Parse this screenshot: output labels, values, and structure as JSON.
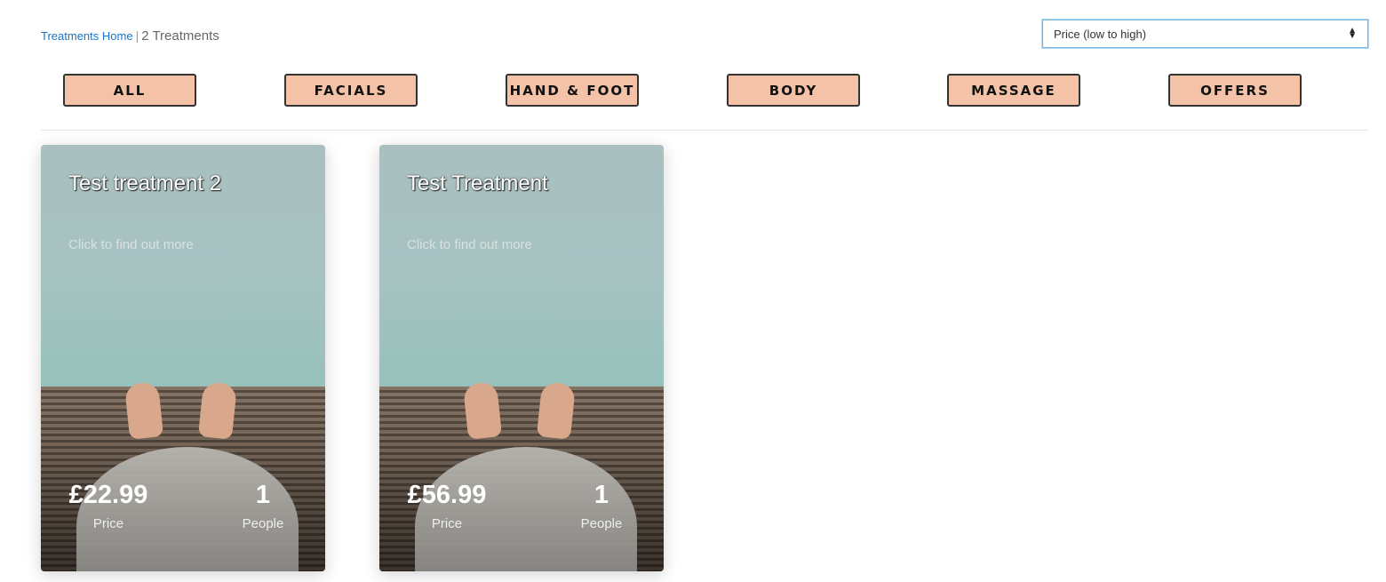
{
  "breadcrumb": {
    "home_label": "Treatments Home",
    "separator": "|",
    "count_label": "2 Treatments"
  },
  "sort": {
    "selected": "Price (low to high)"
  },
  "filters": [
    "ALL",
    "FACIALS",
    "HAND & FOOT",
    "BODY",
    "MASSAGE",
    "OFFERS"
  ],
  "cards": [
    {
      "title": "Test treatment 2",
      "cta": "Click to find out more",
      "price": "£22.99",
      "price_label": "Price",
      "people": "1",
      "people_label": "People"
    },
    {
      "title": "Test Treatment",
      "cta": "Click to find out more",
      "price": "£56.99",
      "price_label": "Price",
      "people": "1",
      "people_label": "People"
    }
  ],
  "colors": {
    "filter_bg": "#f3c2a7",
    "link": "#1a73c7"
  }
}
